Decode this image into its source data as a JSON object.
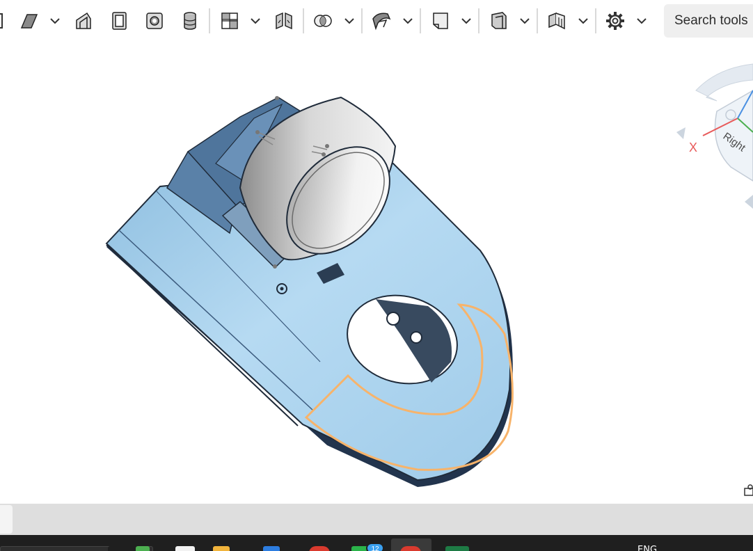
{
  "toolbar": {
    "search_placeholder": "Search tools",
    "tools": [
      {
        "name": "extrude-icon"
      },
      {
        "name": "revolve-icon"
      },
      {
        "name": "sweep-icon"
      },
      {
        "name": "loft-icon"
      },
      {
        "name": "shell-icon"
      },
      {
        "name": "cylinder-icon"
      },
      {
        "name": "pattern-icon"
      },
      {
        "name": "mirror-icon"
      },
      {
        "name": "boolean-icon"
      },
      {
        "name": "surface-icon"
      },
      {
        "name": "plane-icon"
      },
      {
        "name": "sheet-metal-icon"
      },
      {
        "name": "frame-icon"
      },
      {
        "name": "gear-icon"
      }
    ]
  },
  "view_cube": {
    "face_label": "Right",
    "axis_label": "X"
  },
  "taskbar": {
    "language": "ENG",
    "badge_count": "12"
  },
  "colors": {
    "body_blue": "#a9d3ef",
    "edge_dark": "#1f2b3a",
    "highlight_orange": "#f7b36a",
    "ring_gray": "#d5d5d5"
  }
}
